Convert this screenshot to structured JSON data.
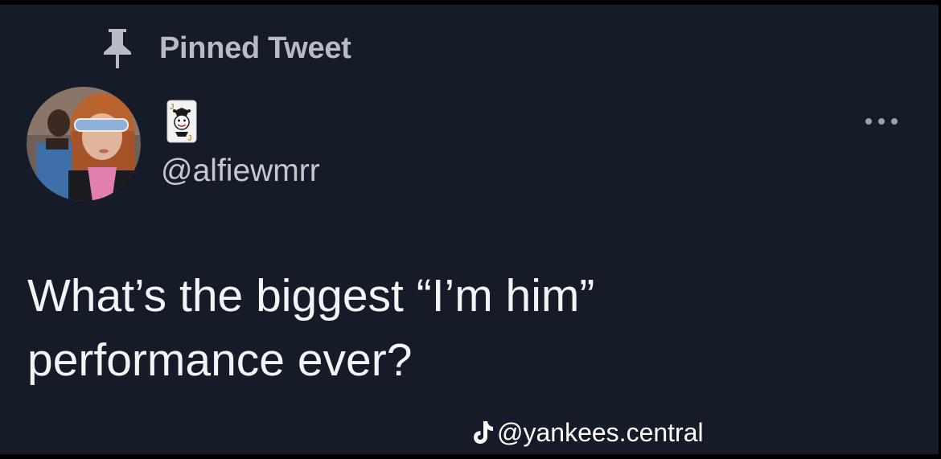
{
  "header": {
    "pinned_label": "Pinned Tweet",
    "pin_icon": "pin-icon"
  },
  "author": {
    "display_name_emoji": "jester-playing-card-emoji",
    "handle": "@alfiewmrr",
    "avatar": "avatar"
  },
  "tweet": {
    "text": "What’s the biggest “I’m him”\nperformance ever?"
  },
  "actions": {
    "more_icon": "more-options-icon"
  },
  "watermark": {
    "platform_icon": "tiktok-icon",
    "text": "@yankees.central"
  },
  "colors": {
    "background": "#151b28",
    "secondary_text": "#b7bcc3",
    "primary_text": "#f2f4f5"
  }
}
